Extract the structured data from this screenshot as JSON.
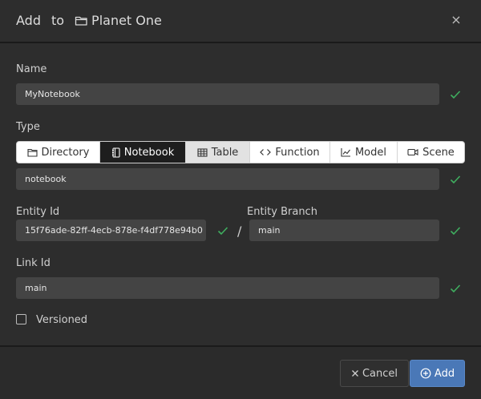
{
  "dialog": {
    "title_add": "Add",
    "title_to": "to",
    "title_target": "Planet One",
    "close_label": "×"
  },
  "fields": {
    "name": {
      "label": "Name",
      "value": "MyNotebook"
    },
    "type": {
      "label": "Type",
      "options": [
        "Directory",
        "Notebook",
        "Table",
        "Function",
        "Model",
        "Scene"
      ],
      "selected": "Notebook",
      "value": "notebook"
    },
    "entity_id": {
      "label": "Entity Id",
      "value": "15f76ade-82ff-4ecb-878e-f4df778e94b0"
    },
    "separator": "/",
    "entity_branch": {
      "label": "Entity Branch",
      "value": "main"
    },
    "link_id": {
      "label": "Link Id",
      "value": "main"
    },
    "versioned": {
      "label": "Versioned",
      "checked": false
    }
  },
  "footer": {
    "cancel_label": "Cancel",
    "add_label": "Add"
  },
  "colors": {
    "background": "#2d2d2d",
    "input": "#444444",
    "valid": "#3fae5f",
    "primary": "#4a78b7"
  }
}
